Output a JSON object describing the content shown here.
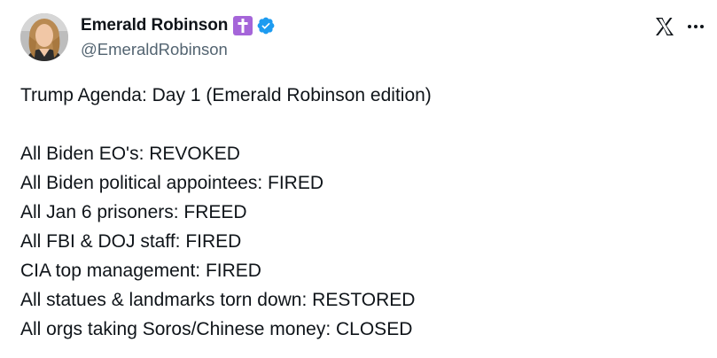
{
  "author": {
    "display_name": "Emerald Robinson",
    "handle": "@EmeraldRobinson",
    "avatar_icon": "user-avatar-photo",
    "badges": [
      {
        "name": "latin-cross-emoji",
        "color": "#a565d9"
      },
      {
        "name": "verified-check-icon",
        "color": "#1d9bf0"
      }
    ]
  },
  "header_controls": {
    "logo_icon": "x-logo-icon",
    "more_icon": "more-horizontal-icon"
  },
  "tweet": {
    "lines": [
      "Trump Agenda: Day 1 (Emerald Robinson edition)",
      "",
      "All Biden EO's: REVOKED",
      "All Biden political appointees: FIRED",
      "All Jan 6 prisoners: FREED",
      "All FBI & DOJ staff: FIRED",
      "CIA top management: FIRED",
      "All statues & landmarks torn down: RESTORED",
      "All orgs taking Soros/Chinese money: CLOSED"
    ]
  },
  "colors": {
    "text_primary": "#0f1419",
    "text_secondary": "#536471",
    "verified_blue": "#1d9bf0",
    "cross_badge_purple": "#a565d9"
  }
}
